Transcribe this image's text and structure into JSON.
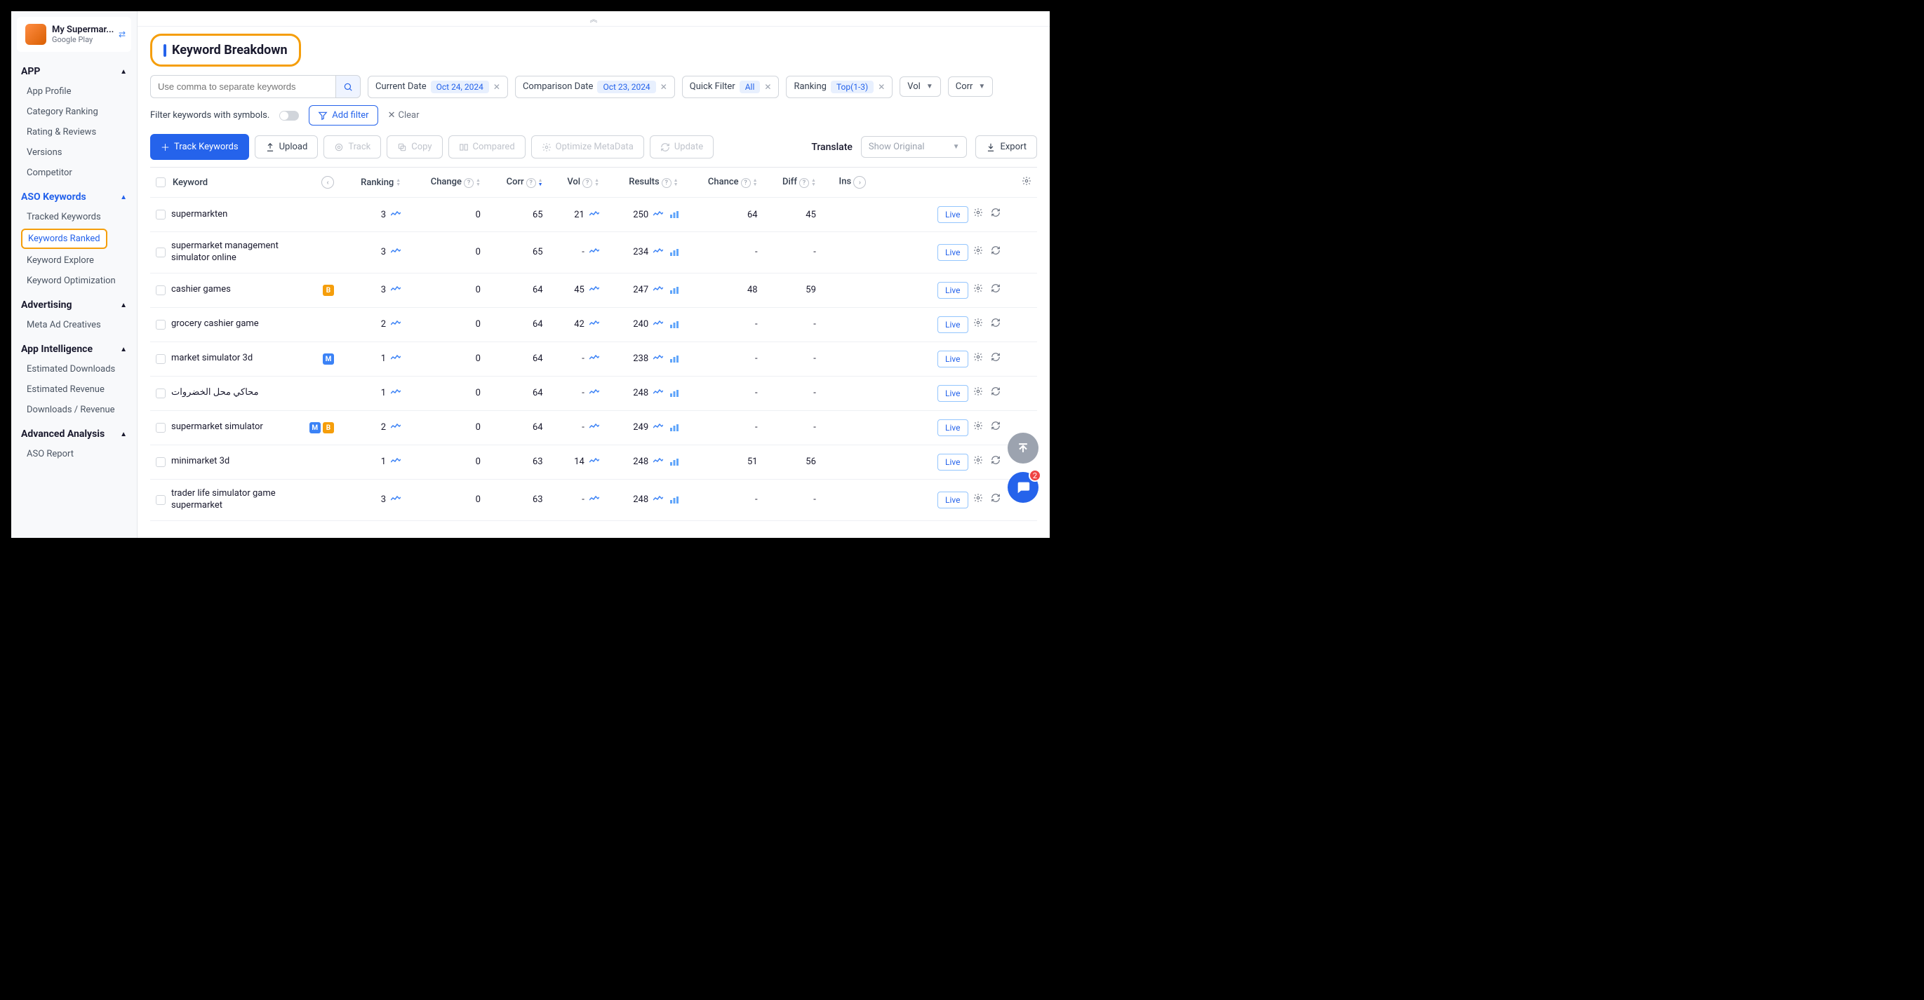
{
  "app_selector": {
    "name": "My Supermar...",
    "store": "Google Play"
  },
  "sidebar": {
    "sections": [
      {
        "title": "APP",
        "items": [
          "App Profile",
          "Category Ranking",
          "Rating & Reviews",
          "Versions",
          "Competitor"
        ]
      },
      {
        "title": "ASO Keywords",
        "blue": true,
        "items": [
          "Tracked Keywords",
          "Keywords Ranked",
          "Keyword Explore",
          "Keyword Optimization"
        ],
        "active_index": 1
      },
      {
        "title": "Advertising",
        "items": [
          "Meta Ad Creatives"
        ]
      },
      {
        "title": "App Intelligence",
        "items": [
          "Estimated Downloads",
          "Estimated Revenue",
          "Downloads / Revenue"
        ]
      },
      {
        "title": "Advanced Analysis",
        "items": [
          "ASO Report"
        ]
      }
    ]
  },
  "page_title": "Keyword Breakdown",
  "search_placeholder": "Use comma to separate keywords",
  "filters": {
    "current_date": {
      "label": "Current Date",
      "value": "Oct 24, 2024"
    },
    "comparison_date": {
      "label": "Comparison Date",
      "value": "Oct 23, 2024"
    },
    "quick_filter": {
      "label": "Quick Filter",
      "value": "All"
    },
    "ranking": {
      "label": "Ranking",
      "value": "Top(1-3)"
    },
    "vol": {
      "label": "Vol"
    },
    "corr": {
      "label": "Corr"
    }
  },
  "sub_filter_label": "Filter keywords with symbols.",
  "add_filter": "Add filter",
  "clear": "Clear",
  "toolbar": {
    "track_keywords": "Track Keywords",
    "upload": "Upload",
    "track": "Track",
    "copy": "Copy",
    "compared": "Compared",
    "optimize": "Optimize MetaData",
    "update": "Update",
    "translate": "Translate",
    "show_original": "Show Original",
    "export": "Export"
  },
  "columns": [
    "Keyword",
    "Ranking",
    "Change",
    "Corr",
    "Vol",
    "Results",
    "Chance",
    "Diff",
    "Ins"
  ],
  "rows": [
    {
      "kw": "supermarkten",
      "badges": [],
      "ranking": 3,
      "change": 0,
      "corr": 65,
      "vol": "21",
      "results": 250,
      "chance": "64",
      "diff": "45"
    },
    {
      "kw": "supermarket management simulator online",
      "badges": [],
      "ranking": 3,
      "change": 0,
      "corr": 65,
      "vol": "-",
      "results": 234,
      "chance": "-",
      "diff": "-"
    },
    {
      "kw": "cashier games",
      "badges": [
        "B"
      ],
      "ranking": 3,
      "change": 0,
      "corr": 64,
      "vol": "45",
      "results": 247,
      "chance": "48",
      "diff": "59"
    },
    {
      "kw": "grocery cashier game",
      "badges": [],
      "ranking": 2,
      "change": 0,
      "corr": 64,
      "vol": "42",
      "results": 240,
      "chance": "-",
      "diff": "-"
    },
    {
      "kw": "market simulator 3d",
      "badges": [
        "M"
      ],
      "ranking": 1,
      "change": 0,
      "corr": 64,
      "vol": "-",
      "results": 238,
      "chance": "-",
      "diff": "-"
    },
    {
      "kw": "محاكي محل الخضروات",
      "badges": [],
      "ranking": 1,
      "change": 0,
      "corr": 64,
      "vol": "-",
      "results": 248,
      "chance": "-",
      "diff": "-"
    },
    {
      "kw": "supermarket simulator",
      "badges": [
        "M",
        "B"
      ],
      "ranking": 2,
      "change": 0,
      "corr": 64,
      "vol": "-",
      "results": 249,
      "chance": "-",
      "diff": "-"
    },
    {
      "kw": "minimarket 3d",
      "badges": [],
      "ranking": 1,
      "change": 0,
      "corr": 63,
      "vol": "14",
      "results": 248,
      "chance": "51",
      "diff": "56"
    },
    {
      "kw": "trader life simulator game supermarket",
      "badges": [],
      "ranking": 3,
      "change": 0,
      "corr": 63,
      "vol": "-",
      "results": 248,
      "chance": "-",
      "diff": "-"
    }
  ],
  "live_label": "Live",
  "chat_notifications": "2"
}
